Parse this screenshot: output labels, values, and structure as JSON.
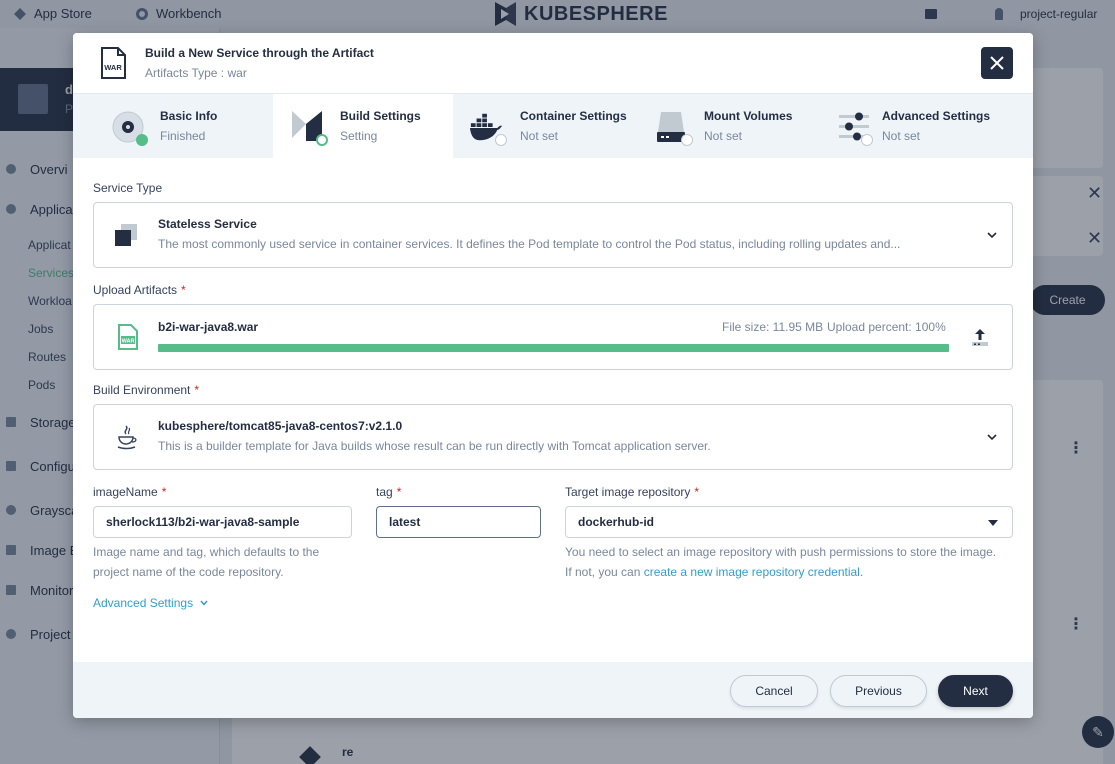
{
  "background": {
    "topbar": {
      "app_store": "App Store",
      "workbench": "Workbench",
      "logo": "KUBESPHERE",
      "user": "project-regular"
    },
    "sidebar": {
      "project_initial": "d",
      "project_sub": "P",
      "overview": "Overvi",
      "applications": "Applica",
      "app_workloads": [
        "Applicat",
        "Services",
        "Workloa",
        "Jobs",
        "Routes",
        "Pods"
      ],
      "storage": "Storage",
      "configuration": "Configu",
      "grayscale": "Graysca",
      "image_builder": "Image B",
      "monitoring": "Monitor",
      "project_settings": "Project"
    },
    "create_button": "Create",
    "list_item_label": "re"
  },
  "modal": {
    "title": "Build a New Service through the Artifact",
    "subtitle": "Artifacts Type : war",
    "file_badge": "WAR",
    "steps": [
      {
        "title": "Basic Info",
        "status": "Finished"
      },
      {
        "title": "Build Settings",
        "status": "Setting"
      },
      {
        "title": "Container Settings",
        "status": "Not set"
      },
      {
        "title": "Mount Volumes",
        "status": "Not set"
      },
      {
        "title": "Advanced Settings",
        "status": "Not set"
      }
    ],
    "service_type": {
      "label": "Service Type",
      "title": "Stateless Service",
      "description": "The most commonly used service in container services. It defines the Pod template to control the Pod status, including rolling updates and..."
    },
    "upload": {
      "label": "Upload Artifacts",
      "required": "*",
      "file_name": "b2i-war-java8.war",
      "file_size": "File size: 11.95 MB",
      "upload_percent": "Upload percent: 100%",
      "progress": 1.0
    },
    "build_env": {
      "label": "Build Environment",
      "required": "*",
      "title": "kubesphere/tomcat85-java8-centos7:v2.1.0",
      "description": "This is a builder template for Java builds whose result can be run directly with Tomcat application server."
    },
    "image_name": {
      "label": "imageName",
      "required": "*",
      "value": "sherlock113/b2i-war-java8-sample",
      "help": "Image name and tag, which defaults to the project name of the code repository."
    },
    "tag": {
      "label": "tag",
      "required": "*",
      "value": "latest"
    },
    "target_repo": {
      "label": "Target image repository",
      "required": "*",
      "value": "dockerhub-id",
      "help_prefix": "You need to select an image repository with push permissions to store the image. If not, you can ",
      "help_link": "create a new image repository credential."
    },
    "advanced_settings_link": "Advanced Settings",
    "footer": {
      "cancel": "Cancel",
      "previous": "Previous",
      "next": "Next"
    }
  },
  "colors": {
    "accent_dark": "#242e42",
    "success_green": "#55bc8a",
    "link_blue": "#329dce",
    "required_red": "#ca2621"
  }
}
